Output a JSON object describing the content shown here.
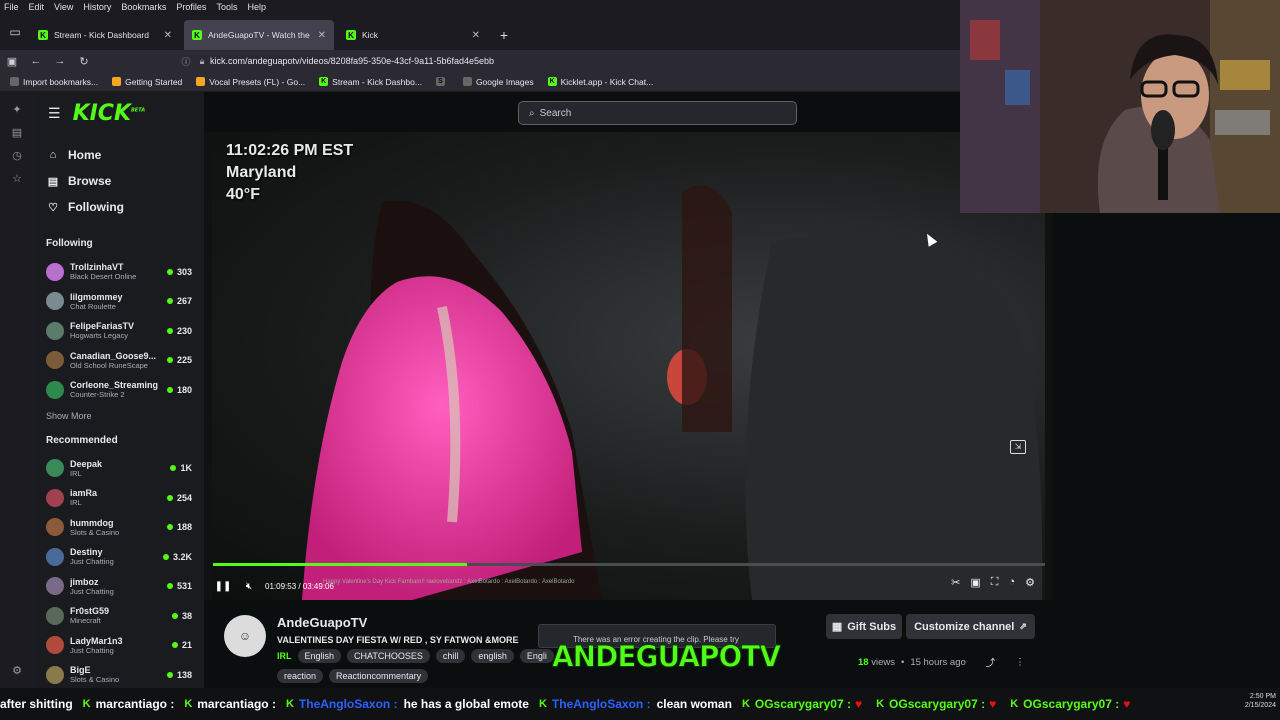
{
  "browser": {
    "menu": [
      "File",
      "Edit",
      "View",
      "History",
      "Bookmarks",
      "Profiles",
      "Tools",
      "Help"
    ],
    "tabs": [
      {
        "label": "Stream - Kick Dashboard",
        "active": false
      },
      {
        "label": "AndeGuapoTV - Watch the",
        "active": true
      },
      {
        "label": "Kick",
        "active": false
      }
    ],
    "url": "kick.com/andeguapotv/videos/8208fa95-350e-43cf-9a11-5b6fad4e5ebb",
    "bookmarks": [
      "Import bookmarks...",
      "Getting Started",
      "Vocal Presets (FL) - Go...",
      "Stream - Kick Dashbo...",
      "",
      "Google Images",
      "Kicklet.app - Kick Chat..."
    ]
  },
  "kick": {
    "logo": "KICK",
    "logo_badge": "BETA",
    "search_placeholder": "Search",
    "nav": [
      {
        "label": "Home",
        "icon": "home-icon"
      },
      {
        "label": "Browse",
        "icon": "browse-icon"
      },
      {
        "label": "Following",
        "icon": "heart-icon"
      }
    ],
    "following_title": "Following",
    "following": [
      {
        "name": "TrollzinhaVT",
        "category": "Black Desert Online",
        "viewers": "303",
        "color": "#b86fd0"
      },
      {
        "name": "lilgmommey",
        "category": "Chat Roulette",
        "viewers": "267",
        "color": "#7a8a8f"
      },
      {
        "name": "FelipeFariasTV",
        "category": "Hogwarts Legacy",
        "viewers": "230",
        "color": "#5a7a6a"
      },
      {
        "name": "Canadian_Goose9...",
        "category": "Old School RuneScape",
        "viewers": "225",
        "color": "#7a5b3a"
      },
      {
        "name": "Corleone_Streaming",
        "category": "Counter-Strike 2",
        "viewers": "180",
        "color": "#2e8a4a"
      }
    ],
    "show_more": "Show More",
    "recommended_title": "Recommended",
    "recommended": [
      {
        "name": "Deepak",
        "category": "IRL",
        "viewers": "1K",
        "color": "#3a8a5a"
      },
      {
        "name": "iamRa",
        "category": "IRL",
        "viewers": "254",
        "color": "#a04050"
      },
      {
        "name": "hummdog",
        "category": "Slots & Casino",
        "viewers": "188",
        "color": "#8a5a3a"
      },
      {
        "name": "Destiny",
        "category": "Just Chatting",
        "viewers": "3.2K",
        "color": "#4a6a9a"
      },
      {
        "name": "jimboz",
        "category": "Just Chatting",
        "viewers": "531",
        "color": "#7a6a8a"
      },
      {
        "name": "Fr0stG59",
        "category": "Minecraft",
        "viewers": "38",
        "color": "#5a6a5a"
      },
      {
        "name": "LadyMar1n3",
        "category": "Just Chatting",
        "viewers": "21",
        "color": "#b04a3a"
      },
      {
        "name": "BigE",
        "category": "Slots & Casino",
        "viewers": "138",
        "color": "#8a7a4a"
      }
    ]
  },
  "player": {
    "overlay_time": "11:02:26 PM EST",
    "overlay_location": "Maryland",
    "overlay_temp": "40°F",
    "current_time": "01:09:53",
    "duration": "03:49:06",
    "progress_fraction": 0.305,
    "chat_strip": "Happy Valentine's Day   Kick Fambam!!   raelovebandz :   AxelBotardo :   AxelBotardo :   AxelBotardo"
  },
  "channel": {
    "name": "AndeGuapoTV",
    "stream_title": "VALENTINES DAY FIESTA W/ RED , SY FATWON &MORE",
    "category": "IRL",
    "tags": [
      "English",
      "CHATCHOOSES",
      "chill",
      "english",
      "Engli"
    ],
    "tags2": [
      "reaction",
      "Reactioncommentary"
    ],
    "gift_subs": "Gift Subs",
    "customize": "Customize channel",
    "views_count": "18",
    "views_label": "views",
    "time_ago": "15 hours ago"
  },
  "toast": {
    "text": "There was an error creating the clip. Please try"
  },
  "brand_overlay": "ANDEGUAPOTV",
  "ticker": [
    {
      "user": "after shitting",
      "msg": "",
      "style": "plain"
    },
    {
      "user": "marcantiago :",
      "msg": "",
      "style": "plain"
    },
    {
      "user": "marcantiago :",
      "msg": "",
      "style": "plain"
    },
    {
      "user": "TheAngloSaxon :",
      "msg": "he has a global emote",
      "style": "blue"
    },
    {
      "user": "TheAngloSaxon :",
      "msg": "clean woman",
      "style": "blue"
    },
    {
      "user": "OGscarygary07 :",
      "msg": "",
      "style": "green"
    },
    {
      "user": "OGscarygary07 :",
      "msg": "",
      "style": "green"
    },
    {
      "user": "OGscarygary07 :",
      "msg": "",
      "style": "green"
    }
  ],
  "clock": {
    "time": "2:50 PM",
    "date": "2/15/2024"
  },
  "colors": {
    "accent": "#53fc18",
    "background": "#0b0e0f",
    "sidebar": "#191b1f"
  }
}
